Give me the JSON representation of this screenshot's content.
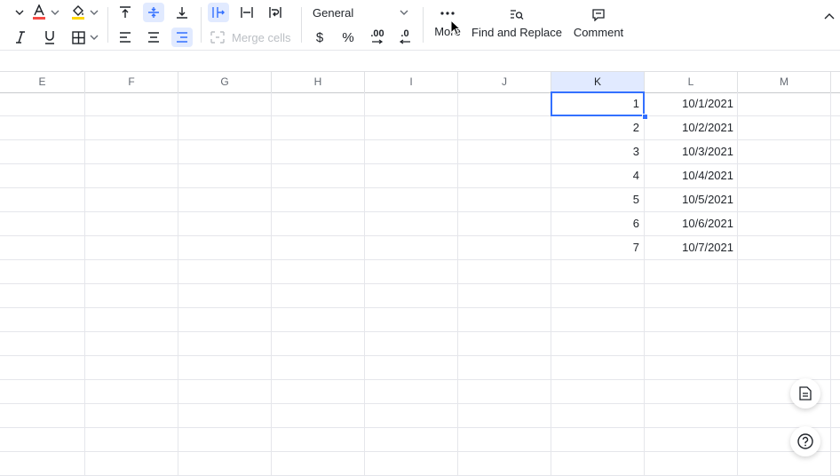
{
  "toolbar": {
    "number_format": "General",
    "merge_cells_label": "Merge cells",
    "more_label": "More",
    "find_replace_label": "Find and Replace",
    "comment_label": "Comment",
    "currency_symbol": "$",
    "percent_symbol": "%",
    "increase_decimal_label": ".00",
    "decrease_decimal_label": ".0",
    "font_color": "#f54a45",
    "fill_color": "#ffd700",
    "accent_color": "#3370ff"
  },
  "columns": [
    "E",
    "F",
    "G",
    "H",
    "I",
    "J",
    "K",
    "L",
    "M"
  ],
  "active_column": "K",
  "rows": [
    {
      "k": "1",
      "l": "10/1/2021"
    },
    {
      "k": "2",
      "l": "10/2/2021"
    },
    {
      "k": "3",
      "l": "10/3/2021"
    },
    {
      "k": "4",
      "l": "10/4/2021"
    },
    {
      "k": "5",
      "l": "10/5/2021"
    },
    {
      "k": "6",
      "l": "10/6/2021"
    },
    {
      "k": "7",
      "l": "10/7/2021"
    }
  ]
}
